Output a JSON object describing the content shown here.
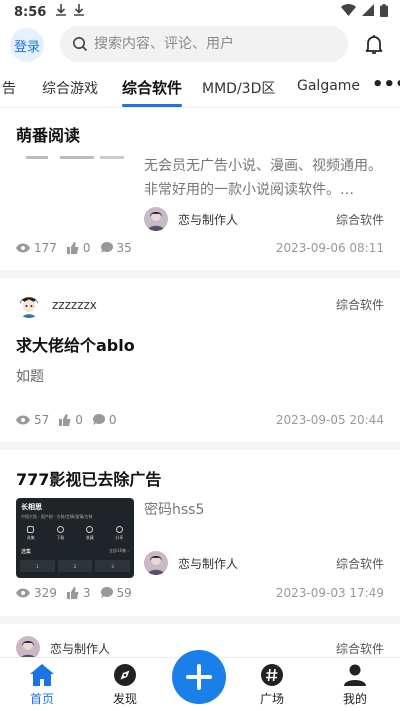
{
  "status_bar": {
    "time": "8:56"
  },
  "header": {
    "login_label": "登录",
    "search_placeholder": "搜索内容、评论、用户"
  },
  "tabs": [
    {
      "label": "告"
    },
    {
      "label": "综合游戏"
    },
    {
      "label": "综合软件",
      "active": true
    },
    {
      "label": "MMD/3D区"
    },
    {
      "label": "Galgame"
    }
  ],
  "more_label": "•••",
  "posts": [
    {
      "title": "萌番阅读",
      "description": "无会员无广告小说、漫画、视频通用。非常好用的一款小说阅读软件。…",
      "author": "恋与制作人",
      "category": "综合软件",
      "views": "177",
      "likes": "0",
      "comments": "35",
      "date": "2023-09-06 08:11"
    },
    {
      "poster": "zzzzzzx",
      "category": "综合软件",
      "title": "求大佬给个ablo",
      "body": "如题",
      "views": "57",
      "likes": "0",
      "comments": "0",
      "date": "2023-09-05 20:44"
    },
    {
      "title": "777影视已去除广告",
      "description": "密码hss5",
      "author": "恋与制作人",
      "category": "综合软件",
      "views": "329",
      "likes": "3",
      "comments": "59",
      "date": "2023-09-03 17:49"
    },
    {
      "poster": "恋与制作人",
      "category": "综合软件"
    }
  ],
  "thumb_text": {
    "app_name": "长相思",
    "line": "中国大陆 · 国产剧 · 古装/言情/爱情/古装",
    "actions": [
      "选集",
      "下载",
      "收藏",
      "分享"
    ],
    "episodes_label": "选集",
    "episodes_more": "全部36集 ›",
    "episodes": [
      "1",
      "2",
      "3"
    ]
  },
  "nav": [
    {
      "label": "首页",
      "icon": "home-icon",
      "active": true
    },
    {
      "label": "发现",
      "icon": "compass-icon"
    },
    {
      "label": "",
      "icon": "plus-icon"
    },
    {
      "label": "广场",
      "icon": "hashtag-icon"
    },
    {
      "label": "我的",
      "icon": "person-icon"
    }
  ],
  "colors": {
    "accent": "#1a73e8",
    "fab": "#1a7fe8"
  }
}
